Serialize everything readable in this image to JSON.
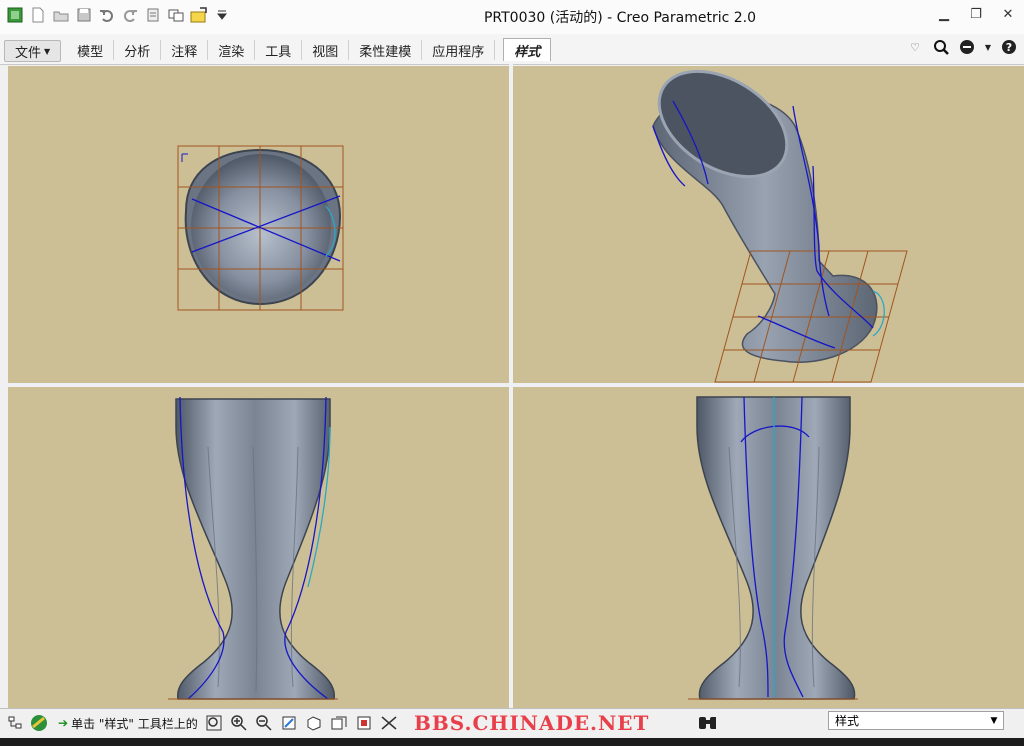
{
  "window": {
    "title": "PRT0030 (活动的) - Creo Parametric 2.0"
  },
  "ribbon": {
    "tabs": [
      "文件",
      "模型",
      "分析",
      "注释",
      "渲染",
      "工具",
      "视图",
      "柔性建模",
      "应用程序",
      "样式"
    ],
    "active_tab": "样式"
  },
  "status": {
    "message": "单击 \"样式\" 工具栏上的",
    "filter_value": "样式"
  },
  "watermark": "BBS.CHINADE.NET",
  "colors": {
    "viewport_bg": "#cdbf95",
    "model": "#7c8593",
    "curve": "#1616c8",
    "plane_grid": "#a0541e"
  },
  "icons": {
    "quick_access": [
      "app-logo-icon",
      "new-file-icon",
      "open-file-icon",
      "save-icon",
      "undo-icon",
      "redo-icon",
      "regenerate-icon",
      "windows-icon",
      "close-window-icon",
      "customize-icon"
    ],
    "ribbon_right": [
      "minimize-ribbon-icon",
      "search-icon",
      "community-icon",
      "help-icon"
    ],
    "status_left": [
      "model-tree-icon",
      "appearance-icon"
    ],
    "view_toolbar": [
      "refit-icon",
      "zoom-in-icon",
      "zoom-out-icon",
      "repaint-icon",
      "display-style-icon",
      "saved-views-icon",
      "view-manager-icon",
      "datum-display-icon"
    ],
    "status_right": [
      "find-icon"
    ]
  }
}
